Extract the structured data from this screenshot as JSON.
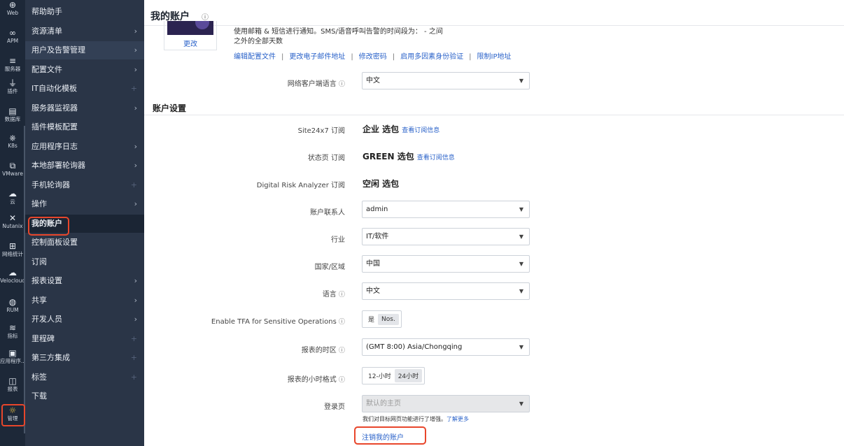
{
  "rail": [
    {
      "label": "Web",
      "icon": "globe-icon",
      "glyph": "⊕"
    },
    {
      "label": "APM",
      "icon": "apm-icon",
      "glyph": "∞"
    },
    {
      "label": "服务器",
      "icon": "server-icon",
      "glyph": "≡"
    },
    {
      "label": "插件",
      "icon": "plug-icon",
      "glyph": "⏚"
    },
    {
      "label": "数据库",
      "icon": "database-icon",
      "glyph": "▤"
    },
    {
      "label": "K8s",
      "icon": "kubernetes-icon",
      "glyph": "⎈"
    },
    {
      "label": "VMware",
      "icon": "vmware-icon",
      "glyph": "⧉"
    },
    {
      "label": "云",
      "icon": "cloud-icon",
      "glyph": "☁"
    },
    {
      "label": "Nutanix",
      "icon": "nutanix-icon",
      "glyph": "✕"
    },
    {
      "label": "网络统计",
      "icon": "network-icon",
      "glyph": "⊞"
    },
    {
      "label": "Velocloud",
      "icon": "velocloud-icon",
      "glyph": "☁"
    },
    {
      "label": "RUM",
      "icon": "rum-icon",
      "glyph": "◍"
    },
    {
      "label": "指标",
      "icon": "metrics-icon",
      "glyph": "≋"
    },
    {
      "label": "应用程序...",
      "icon": "application-icon",
      "glyph": "▣"
    },
    {
      "label": "报表",
      "icon": "report-icon",
      "glyph": "◫"
    },
    {
      "label": "管理",
      "icon": "admin-gear-icon",
      "glyph": "☼"
    }
  ],
  "menu": [
    {
      "label": "帮助助手",
      "kind": "none"
    },
    {
      "label": "资源清单",
      "kind": "arrow"
    },
    {
      "label": "用户及告警管理",
      "kind": "arrow"
    },
    {
      "label": "配置文件",
      "kind": "arrow"
    },
    {
      "label": "IT自动化模板",
      "kind": "plus"
    },
    {
      "label": "服务器监视器",
      "kind": "arrow"
    },
    {
      "label": "插件模板配置",
      "kind": "none"
    },
    {
      "label": "应用程序日志",
      "kind": "arrow"
    },
    {
      "label": "本地部署轮询器",
      "kind": "arrow"
    },
    {
      "label": "手机轮询器",
      "kind": "plus"
    },
    {
      "label": "操作",
      "kind": "arrow"
    },
    {
      "label": "我的账户",
      "kind": "none"
    },
    {
      "label": "控制面板设置",
      "kind": "none"
    },
    {
      "label": "订阅",
      "kind": "none"
    },
    {
      "label": "报表设置",
      "kind": "arrow"
    },
    {
      "label": "共享",
      "kind": "arrow"
    },
    {
      "label": "开发人员",
      "kind": "arrow"
    },
    {
      "label": "里程碑",
      "kind": "plus"
    },
    {
      "label": "第三方集成",
      "kind": "plus"
    },
    {
      "label": "标签",
      "kind": "plus"
    },
    {
      "label": "下载",
      "kind": "none"
    }
  ],
  "header": {
    "title": "我的账户",
    "info_glyph": "ⓘ"
  },
  "profile": {
    "change_label": "更改",
    "notice_line1": "使用邮箱 & 短信进行通知。SMS/语音呼叫告警的时间段为：  - 之间",
    "notice_line2": "之外的全部天数",
    "links": [
      "编辑配置文件",
      "更改电子邮件地址",
      "修改密码",
      "启用多因素身份验证",
      "限制IP地址"
    ],
    "link_separator": "|"
  },
  "fields": {
    "client_lang_label": "网络客户端语言",
    "client_lang_value": "中文",
    "section_title": "账户设置",
    "site24x7_label": "Site24x7 订阅",
    "site24x7_value": "企业 选包",
    "site24x7_link": "查看订阅信息",
    "status_label": "状态页 订阅",
    "status_value": "GREEN 选包",
    "status_link": "查看订阅信息",
    "dra_label": "Digital Risk Analyzer 订阅",
    "dra_value": "空闲 选包",
    "contact_label": "账户联系人",
    "contact_value": "admin",
    "industry_label": "行业",
    "industry_value": "IT/软件",
    "country_label": "国家/区域",
    "country_value": "中国",
    "language_label": "语言",
    "language_value": "中文",
    "tfa_label": "Enable TFA for Sensitive Operations",
    "tfa_yes": "是",
    "tfa_no": "Nos.",
    "timezone_label": "报表的时区",
    "timezone_value": "(GMT 8:00) Asia/Chongqing",
    "hour_label": "报表的小时格式",
    "hour_12": "12-小时",
    "hour_24": "24小时",
    "landing_label": "登录页",
    "landing_value": "默认的主页",
    "landing_note": "我们对目标网页功能进行了增强。",
    "landing_more": "了解更多",
    "cancel_account": "注销我的账户",
    "info_glyph": "ⓘ",
    "caret_glyph": "▼"
  }
}
